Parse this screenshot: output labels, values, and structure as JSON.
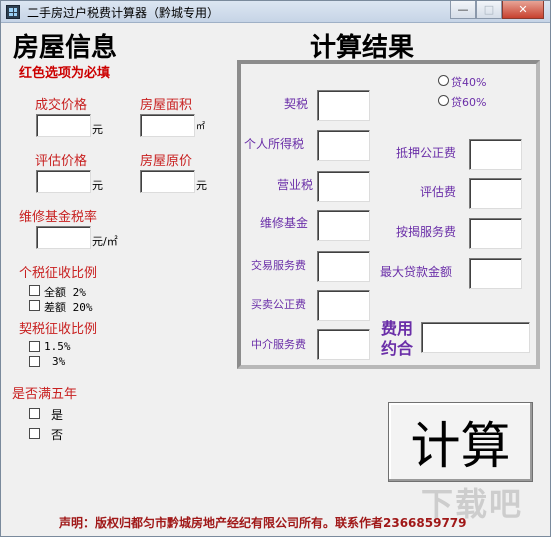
{
  "window": {
    "title": "二手房过户税费计算器（黔城专用）",
    "buttons": {
      "minimize": "—",
      "maximize": "□",
      "close": "✕"
    }
  },
  "left": {
    "heading": "房屋信息",
    "required_note": "红色选项为必填",
    "deal_price_label": "成交价格",
    "deal_price_unit": "元",
    "area_label": "房屋面积",
    "area_unit": "㎡",
    "appraisal_label": "评估价格",
    "appraisal_unit": "元",
    "original_price_label": "房屋原价",
    "original_price_unit": "元",
    "maint_fund_label": "维修基金税率",
    "maint_fund_unit": "元/㎡",
    "income_tax_label": "个税征收比例",
    "income_tax_options": [
      "全额  2%",
      "差额 20%"
    ],
    "deed_tax_label": "契税征收比例",
    "deed_tax_options": [
      "1.5%",
      "3%"
    ],
    "five_years_label": "是否满五年",
    "five_years_options": [
      "是",
      "否"
    ]
  },
  "right": {
    "heading": "计算结果",
    "loan_options": [
      "贷40%",
      "贷60%"
    ],
    "deed_tax": "契税",
    "income_tax": "个人所得税",
    "business_tax": "营业税",
    "maint_fund": "维修基金",
    "transaction_fee": "交易服务费",
    "notary_fee": "买卖公正费",
    "agency_fee": "中介服务费",
    "mortgage_notary_fee": "抵押公正费",
    "appraisal_fee": "评估费",
    "mortgage_service_fee": "按揭服务费",
    "max_loan": "最大贷款金额",
    "total_fee_label": "费用约合"
  },
  "calc_button": "计算",
  "footer": "声明：版权归都匀市黔城房地产经纪有限公司所有。联系作者2366859779",
  "watermark": "下载吧",
  "colors": {
    "required_red": "#cc0000",
    "label_purple": "#6a2ea8",
    "footer_red": "#a01818"
  }
}
